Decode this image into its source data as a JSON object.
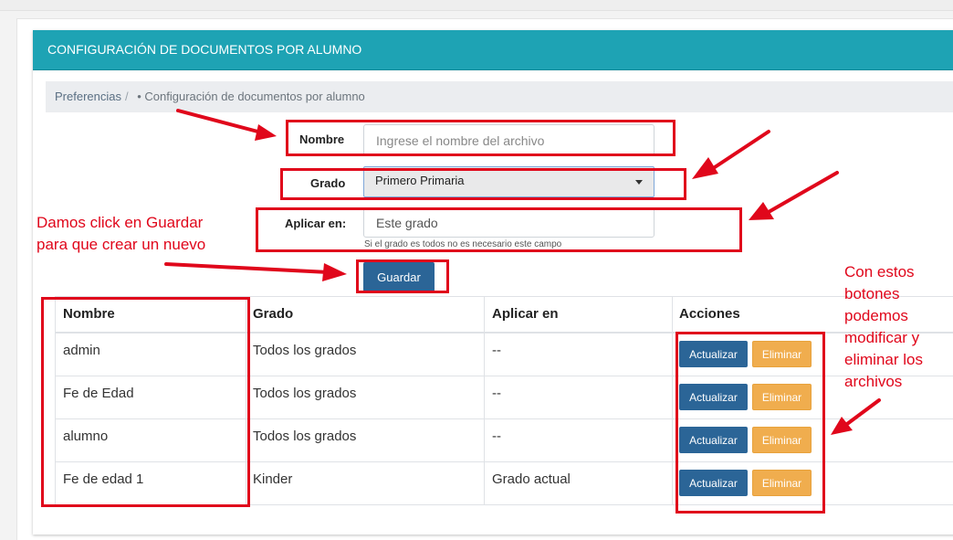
{
  "card": {
    "title": "CONFIGURACIÓN DE DOCUMENTOS POR ALUMNO"
  },
  "breadcrumb": {
    "items": [
      "Preferencias",
      "Configuración de documentos por alumno"
    ]
  },
  "form": {
    "nombre": {
      "label": "Nombre",
      "placeholder": "Ingrese el nombre del archivo"
    },
    "grado": {
      "label": "Grado",
      "selected": "Primero Primaria"
    },
    "aplicar": {
      "label": "Aplicar en:",
      "value": "Este grado",
      "help": "Si el grado es todos no es necesario este campo"
    },
    "guardar_label": "Guardar"
  },
  "table": {
    "headers": [
      "Nombre",
      "Grado",
      "Aplicar en",
      "Acciones"
    ],
    "rows": [
      {
        "nombre": "admin",
        "grado": "Todos los grados",
        "aplicar": "--"
      },
      {
        "nombre": "Fe de Edad",
        "grado": "Todos los grados",
        "aplicar": "--"
      },
      {
        "nombre": "alumno",
        "grado": "Todos los grados",
        "aplicar": "--"
      },
      {
        "nombre": "Fe de edad 1",
        "grado": "Kinder",
        "aplicar": "Grado actual"
      }
    ],
    "actualizar_label": "Actualizar",
    "eliminar_label": "Eliminar"
  },
  "annotations": {
    "guardar_note": [
      "Damos click en Guardar",
      "para que crear un nuevo"
    ],
    "actions_note": [
      "Con estos",
      "botones",
      "podemos",
      "modificar y",
      "eliminar los",
      "archivos"
    ],
    "color": "#e0071b"
  },
  "colors": {
    "header": "#1ea3b4",
    "primary": "#2b6597",
    "warning": "#f0ad4e"
  }
}
